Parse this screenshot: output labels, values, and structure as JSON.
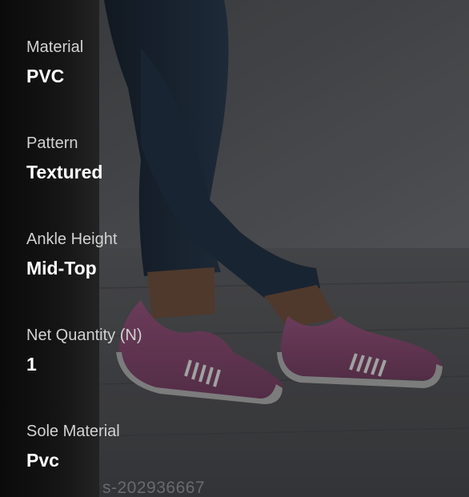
{
  "attributes": [
    {
      "label": "Material",
      "value": "PVC"
    },
    {
      "label": "Pattern",
      "value": "Textured"
    },
    {
      "label": "Ankle Height",
      "value": "Mid-Top"
    },
    {
      "label": "Net Quantity (N)",
      "value": "1"
    },
    {
      "label": "Sole Material",
      "value": "Pvc"
    }
  ],
  "watermark": "s-202936667",
  "photo": {
    "subject": "woman-wearing-pink-knit-slip-on-sneakers",
    "colors": {
      "wall": "#54565a",
      "floor": "#47484b",
      "jeans": "#1b2633",
      "shoe_upper": "#6b3b58",
      "sole": "#8c8c8c",
      "skin": "#5e4436"
    }
  }
}
